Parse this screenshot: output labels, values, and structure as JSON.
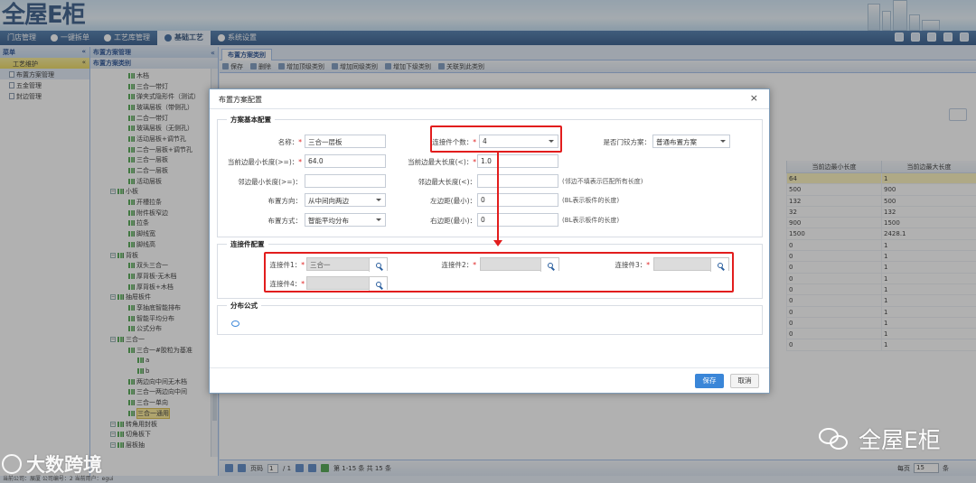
{
  "header": {
    "logo": "全屋E柜"
  },
  "topnav": [
    {
      "label": "门店管理"
    },
    {
      "label": "一键拆单"
    },
    {
      "label": "工艺库管理"
    },
    {
      "label": "基础工艺"
    },
    {
      "label": "系统设置"
    }
  ],
  "leftmenu": {
    "title": "菜单",
    "section": "工艺维护",
    "items": [
      {
        "label": "布置方案管理"
      },
      {
        "label": "五金管理"
      },
      {
        "label": "封边管理"
      }
    ]
  },
  "treepanel": {
    "title": "布置方案管理",
    "subtitle": "布置方案类别",
    "nodes": [
      {
        "label": "木档",
        "level": 3
      },
      {
        "label": "三合一带灯",
        "level": 3
      },
      {
        "label": "弹夹式隐形件（测试）",
        "level": 3
      },
      {
        "label": "玻璃层板（带侧孔）",
        "level": 3
      },
      {
        "label": "二合一带灯",
        "level": 3
      },
      {
        "label": "玻璃层板（无侧孔）",
        "level": 3
      },
      {
        "label": "活动层板+调节孔",
        "level": 3
      },
      {
        "label": "二合一层板+调节孔",
        "level": 3
      },
      {
        "label": "三合一层板",
        "level": 3
      },
      {
        "label": "二合一层板",
        "level": 3
      },
      {
        "label": "活动层板",
        "level": 3
      },
      {
        "label": "小板",
        "level": 2
      },
      {
        "label": "开槽拉条",
        "level": 3
      },
      {
        "label": "附件板窄边",
        "level": 3
      },
      {
        "label": "拉条",
        "level": 3
      },
      {
        "label": "脚线宽",
        "level": 3
      },
      {
        "label": "脚线高",
        "level": 3
      },
      {
        "label": "背板",
        "level": 2
      },
      {
        "label": "双头三合一",
        "level": 3
      },
      {
        "label": "厚背板-无木档",
        "level": 3
      },
      {
        "label": "厚背板+木档",
        "level": 3
      },
      {
        "label": "抽屉板件",
        "level": 2
      },
      {
        "label": "孪抽底智能排布",
        "level": 3
      },
      {
        "label": "智能平均分布",
        "level": 3
      },
      {
        "label": "公式分布",
        "level": 3
      },
      {
        "label": "三合一",
        "level": 2
      },
      {
        "label": "三合一#胶粒为基准",
        "level": 3
      },
      {
        "label": "a",
        "level": 4
      },
      {
        "label": "b",
        "level": 4
      },
      {
        "label": "两边向中间无木档",
        "level": 3
      },
      {
        "label": "三合一两边向中间",
        "level": 3
      },
      {
        "label": "三合一单向",
        "level": 3
      },
      {
        "label": "三合一通用",
        "level": 3
      },
      {
        "label": "转角用封板",
        "level": 2
      },
      {
        "label": "切角板下",
        "level": 2
      },
      {
        "label": "层板抽",
        "level": 2
      }
    ]
  },
  "main": {
    "tab": "布置方案类别",
    "toolbar": [
      {
        "label": "保存"
      },
      {
        "label": "删除"
      },
      {
        "label": "增加顶级类别"
      },
      {
        "label": "增加同级类别"
      },
      {
        "label": "增加下级类别"
      },
      {
        "label": "关联到此类别"
      }
    ],
    "grid": {
      "columns": [
        "当前边最小长度",
        "当前边最大长度"
      ],
      "rows": [
        [
          "64",
          "1"
        ],
        [
          "500",
          "900"
        ],
        [
          "132",
          "500"
        ],
        [
          "32",
          "132"
        ],
        [
          "900",
          "1500"
        ],
        [
          "1500",
          "2428.1"
        ],
        [
          "0",
          "1"
        ],
        [
          "0",
          "1"
        ],
        [
          "0",
          "1"
        ],
        [
          "0",
          "1"
        ],
        [
          "0",
          "1"
        ],
        [
          "0",
          "1"
        ],
        [
          "0",
          "1"
        ],
        [
          "0",
          "1"
        ],
        [
          "0",
          "1"
        ],
        [
          "0",
          "1"
        ]
      ]
    },
    "pager": {
      "page_label": "页码",
      "page": "1",
      "of": "/ 1",
      "summary": "第 1-15 条  共 15 条",
      "per_page_label": "每页",
      "per_page": "15",
      "unit": "条"
    }
  },
  "statusbar": "当前公司：展厦  公司编号：2  当前用户：egui",
  "dialog": {
    "title": "布置方案配置",
    "basic": {
      "legend": "方案基本配置",
      "name_label": "名称：",
      "name_value": "三合一层板",
      "count_label": "连接件个数：",
      "count_value": "4",
      "door_label": "是否门铰方案：",
      "door_value": "普通布置方案",
      "minlen_label": "当前边最小长度(>=)：",
      "minlen_value": "64.0",
      "maxlen_label": "当前边最大长度(<)：",
      "maxlen_value": "1.0",
      "adjmin_label": "邻边最小长度(>=)：",
      "adjmin_value": "",
      "adjmax_label": "邻边最大长度(<)：",
      "adjmax_value": "",
      "adjmax_hint": "(邻边不填表示匹配所有长度)",
      "direction_label": "布置方向：",
      "direction_value": "从中间向两边",
      "leftmargin_label": "左边距(最小)：",
      "leftmargin_value": "0",
      "leftmargin_hint": "(BL表示板件的长度)",
      "mode_label": "布置方式：",
      "mode_value": "智能平均分布",
      "rightmargin_label": "右边距(最小)：",
      "rightmargin_value": "0",
      "rightmargin_hint": "(BL表示板件的长度)"
    },
    "connectors": {
      "legend": "连接件配置",
      "c1_label": "连接件1：",
      "c1_value": "三合一",
      "c2_label": "连接件2：",
      "c2_value": "",
      "c3_label": "连接件3：",
      "c3_value": "",
      "c4_label": "连接件4：",
      "c4_value": ""
    },
    "formula": {
      "legend": "分布公式"
    },
    "save_label": "保存",
    "cancel_label": "取消"
  },
  "watermarks": {
    "left": "大数跨境",
    "right": "全屋E柜"
  },
  "colors": {
    "highlight_red": "#e21d1d",
    "save_blue": "#3a86d8",
    "nav_blue": "#1f4a7f"
  }
}
